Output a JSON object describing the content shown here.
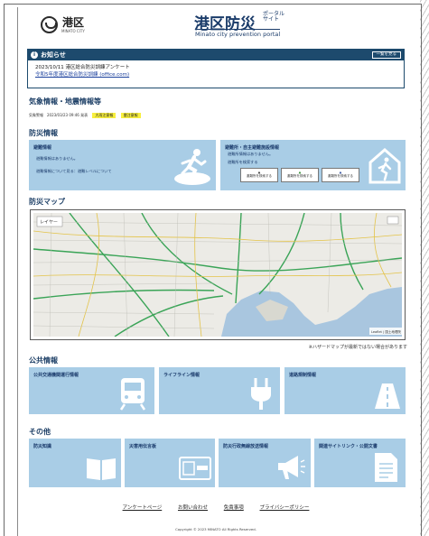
{
  "header": {
    "ward_name": "港区",
    "ward_name_en": "MINATO CITY",
    "portal_title": "港区防災",
    "portal_suffix": "ポータルサイト",
    "portal_subtitle": "Minato city prevention portal"
  },
  "notice": {
    "title": "お知らせ",
    "list_button": "一覧を見る",
    "date_line": "2023/10/11 港区総合防災訓練アンケート",
    "link_text": "令和5年度港区総合防災訓練 (office.com)"
  },
  "weather": {
    "title": "気象情報・地震情報等",
    "timestamp": "気象警報　2023/03/23 09:46 発表",
    "badges": [
      "大雨注意報",
      "雷注意報"
    ]
  },
  "disaster": {
    "title": "防災情報",
    "evacuation": {
      "title": "避難情報",
      "text1": "避難情報はありません。",
      "text2": "避難情報について見る：避難レベルについて"
    },
    "shelter": {
      "title": "避難所・自主避難施設情報",
      "text1": "避難所情報はありません。",
      "text2": "避難所を検索する",
      "boxes": [
        "避難所を検索する",
        "避難所を検索する",
        "避難所を検索する"
      ]
    }
  },
  "map": {
    "title": "防災マップ",
    "layer_label": "レイヤー",
    "attribution": "Leaflet | 国土地理院",
    "note": "※ハザードマップが最新ではない場合があります"
  },
  "public": {
    "title": "公共情報",
    "cards": [
      "公共交通機関運行情報",
      "ライフライン情報",
      "道路規制情報"
    ]
  },
  "other": {
    "title": "その他",
    "cards": [
      "防災知識",
      "災害用伝言板",
      "防災行政無線放送情報",
      "関連サイトリンク・公開文書"
    ]
  },
  "footer": {
    "links": [
      "アンケートページ",
      "お問い合わせ",
      "免責事項",
      "プライバシーポリシー"
    ],
    "copyright": "Copyright © 2023 MINATO All Rights Reserved."
  },
  "colors": {
    "card_blue": "#a9cde6",
    "navy": "#1d4a6d",
    "badge_yellow": "#f7ef3e"
  }
}
